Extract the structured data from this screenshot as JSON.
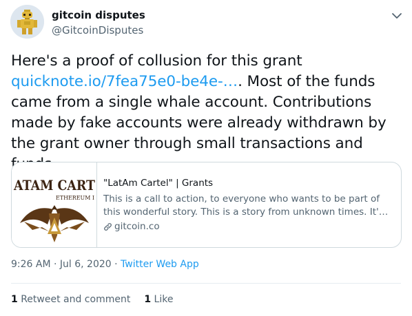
{
  "author": {
    "display_name": "gitcoin disputes",
    "handle": "@GitcoinDisputes",
    "avatar_icon": "robot-droid-avatar"
  },
  "tweet": {
    "text_before_link": "Here's a proof of collusion for this grant ",
    "link_text": "quicknote.io/7fea75e0-be4e-…",
    "text_after_link": ". Most of the funds came from a single whale account. Contributions made by fake accounts were already withdrawn by the grant owner through small transactions and funds ..."
  },
  "card": {
    "image_title_line1": "ATAM CART",
    "image_title_line2": "ETHEREUM I",
    "title": "\"LatAm Cartel\" | Grants",
    "description_line1": "This is a call to action, to everyone who wants to be part of",
    "description_line2": "this wonderful story. This is a story from unknown times. It'…",
    "domain": "gitcoin.co",
    "domain_icon": "link-icon"
  },
  "meta": {
    "time": "9:26 AM",
    "date": "Jul 6, 2020",
    "separator": " · ",
    "source": "Twitter Web App"
  },
  "stats": {
    "retweets_count": "1",
    "retweets_label": "Retweet and comment",
    "likes_count": "1",
    "likes_label": "Like"
  },
  "colors": {
    "link": "#1d9bf0",
    "text": "#0f1419",
    "secondary": "#536471",
    "border": "#cfd9de"
  }
}
